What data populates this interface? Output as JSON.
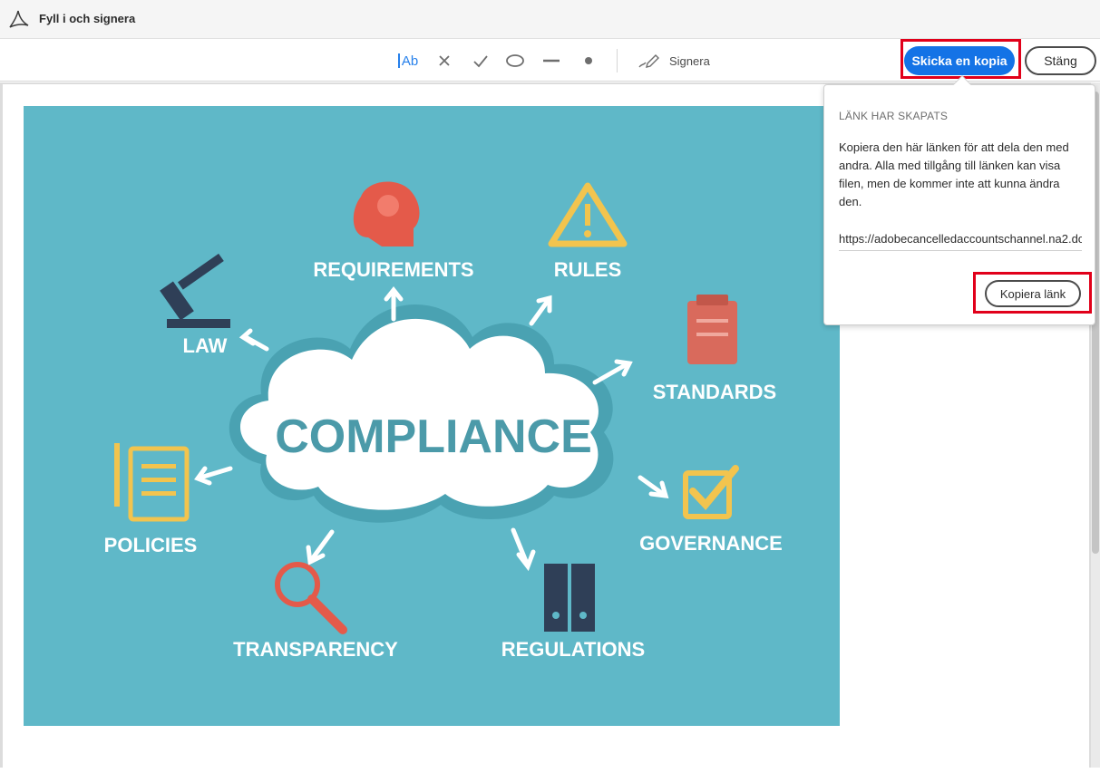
{
  "app": {
    "title": "Fyll i och signera",
    "logo_icon": "acrobat-logo-icon"
  },
  "toolbar": {
    "text_tool_label": "Ab",
    "sign_label": "Signera",
    "send_copy_label": "Skicka en kopia",
    "close_label": "Stäng",
    "accent_color": "#1473e6"
  },
  "popover": {
    "heading": "LÄNK HAR SKAPATS",
    "description": "Kopiera den här länken för att dela den med andra. Alla med tillgång till länken kan visa filen, men de kommer inte att kunna ändra den.",
    "link_value": "https://adobecancelledaccountschannel.na2.do",
    "copy_button_label": "Kopiera länk"
  },
  "document_image": {
    "center_text": "COMPLIANCE",
    "labels": {
      "requirements": "REQUIREMENTS",
      "rules": "RULES",
      "law": "LAW",
      "standards": "STANDARDS",
      "policies": "POLICIES",
      "governance": "GOVERNANCE",
      "transparency": "TRANSPARENCY",
      "regulations": "REGULATIONS"
    },
    "background_color": "#5fb8c8"
  }
}
